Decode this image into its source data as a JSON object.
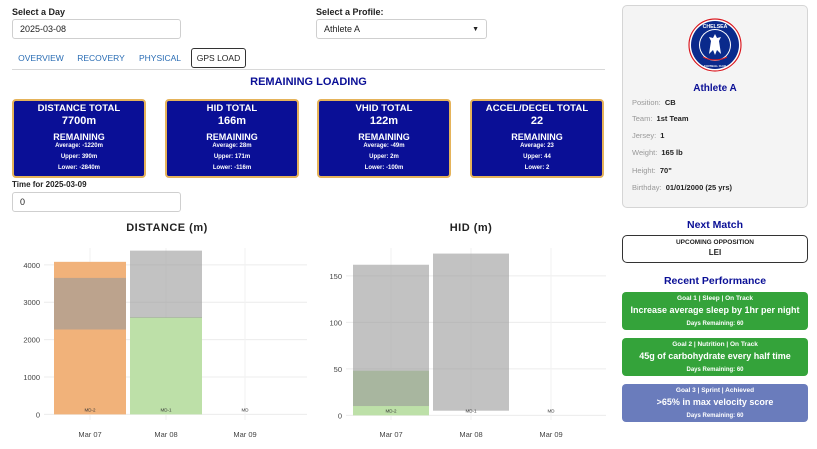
{
  "date_picker": {
    "label": "Select a Day",
    "value": "2025-03-08"
  },
  "profile_select": {
    "label": "Select a Profile:",
    "value": "Athlete A"
  },
  "tabs": [
    {
      "label": "OVERVIEW",
      "active": false
    },
    {
      "label": "RECOVERY",
      "active": false
    },
    {
      "label": "PHYSICAL",
      "active": false
    },
    {
      "label": "GPS LOAD",
      "active": true
    }
  ],
  "section_title": "REMAINING LOADING",
  "cards": [
    {
      "title": "DISTANCE TOTAL",
      "value": "7700m",
      "remaining_label": "REMAINING",
      "average": "Average: -1220m",
      "upper": "Upper: 390m",
      "lower": "Lower: -2840m"
    },
    {
      "title": "HID TOTAL",
      "value": "166m",
      "remaining_label": "REMAINING",
      "average": "Average: 28m",
      "upper": "Upper: 171m",
      "lower": "Lower: -116m"
    },
    {
      "title": "VHID TOTAL",
      "value": "122m",
      "remaining_label": "REMAINING",
      "average": "Average: -49m",
      "upper": "Upper: 2m",
      "lower": "Lower: -100m"
    },
    {
      "title": "ACCEL/DECEL TOTAL",
      "value": "22",
      "remaining_label": "REMAINING",
      "average": "Average: 23",
      "upper": "Upper: 44",
      "lower": "Lower: 2"
    }
  ],
  "time_input": {
    "label": "Time for 2025-03-09",
    "value": "0"
  },
  "colors": {
    "card_bg": "#0a0f96",
    "card_border": "#e5b35a",
    "accent_blue": "#0a0f96",
    "orange": "#f1b27a",
    "green": "#bde0a8",
    "grey": "#bdbdbd",
    "goal_green": "#34a33a",
    "goal_blue": "#6a7cbc"
  },
  "chart_data": [
    {
      "type": "bar",
      "title": "DISTANCE (m)",
      "categories": [
        "Mar 07",
        "Mar 08",
        "Mar 09"
      ],
      "bar_labels": [
        "MD-2",
        "MD-1",
        "MD"
      ],
      "series": [
        {
          "values": [
            4080,
            2600,
            0
          ],
          "colors": [
            "#f1b27a",
            "#bde0a8",
            "#bde0a8"
          ]
        }
      ],
      "bands": [
        {
          "lower": 2270,
          "upper": 3650
        },
        {
          "lower": 2580,
          "upper": 4380
        },
        null
      ],
      "yticks": [
        0,
        1000,
        2000,
        3000,
        4000
      ],
      "ylim": [
        -150,
        4450
      ]
    },
    {
      "type": "bar",
      "title": "HID (m)",
      "categories": [
        "Mar 07",
        "Mar 08",
        "Mar 09"
      ],
      "bar_labels": [
        "MD-2",
        "MD-1",
        "MD"
      ],
      "series": [
        {
          "values": [
            48,
            0,
            0
          ],
          "colors": [
            "#bde0a8",
            "#bde0a8",
            "#bde0a8"
          ]
        }
      ],
      "bands": [
        {
          "lower": 10,
          "upper": 162
        },
        {
          "lower": 5,
          "upper": 174
        },
        null
      ],
      "yticks": [
        0,
        50,
        100,
        150
      ],
      "ylim": [
        -5,
        180
      ]
    }
  ],
  "profile": {
    "club_name": "CHELSEA",
    "club_subtitle": "FOOTBALL CLUB",
    "name": "Athlete A",
    "fields": [
      {
        "label": "Position:",
        "value": "CB"
      },
      {
        "label": "Team:",
        "value": "1st Team"
      },
      {
        "label": "Jersey:",
        "value": "1"
      },
      {
        "label": "Weight:",
        "value": "165 lb"
      },
      {
        "label": "Height:",
        "value": "70\""
      },
      {
        "label": "Birthday:",
        "value": "01/01/2000 (25 yrs)"
      }
    ]
  },
  "next_match": {
    "title": "Next Match",
    "label": "UPCOMING OPPOSITION",
    "opponent": "LEI"
  },
  "recent_performance": {
    "title": "Recent Performance",
    "goals": [
      {
        "header": "Goal 1 | Sleep | On Track",
        "text": "Increase average sleep by 1hr per night",
        "days": "Days Remaining: 60",
        "color": "#34a33a"
      },
      {
        "header": "Goal 2 | Nutrition | On Track",
        "text": "45g of carbohydrate every half time",
        "days": "Days Remaining: 60",
        "color": "#34a33a"
      },
      {
        "header": "Goal 3 | Sprint | Achieved",
        "text": ">65% in max velocity score",
        "days": "Days Remaining: 60",
        "color": "#6a7cbc"
      }
    ]
  }
}
